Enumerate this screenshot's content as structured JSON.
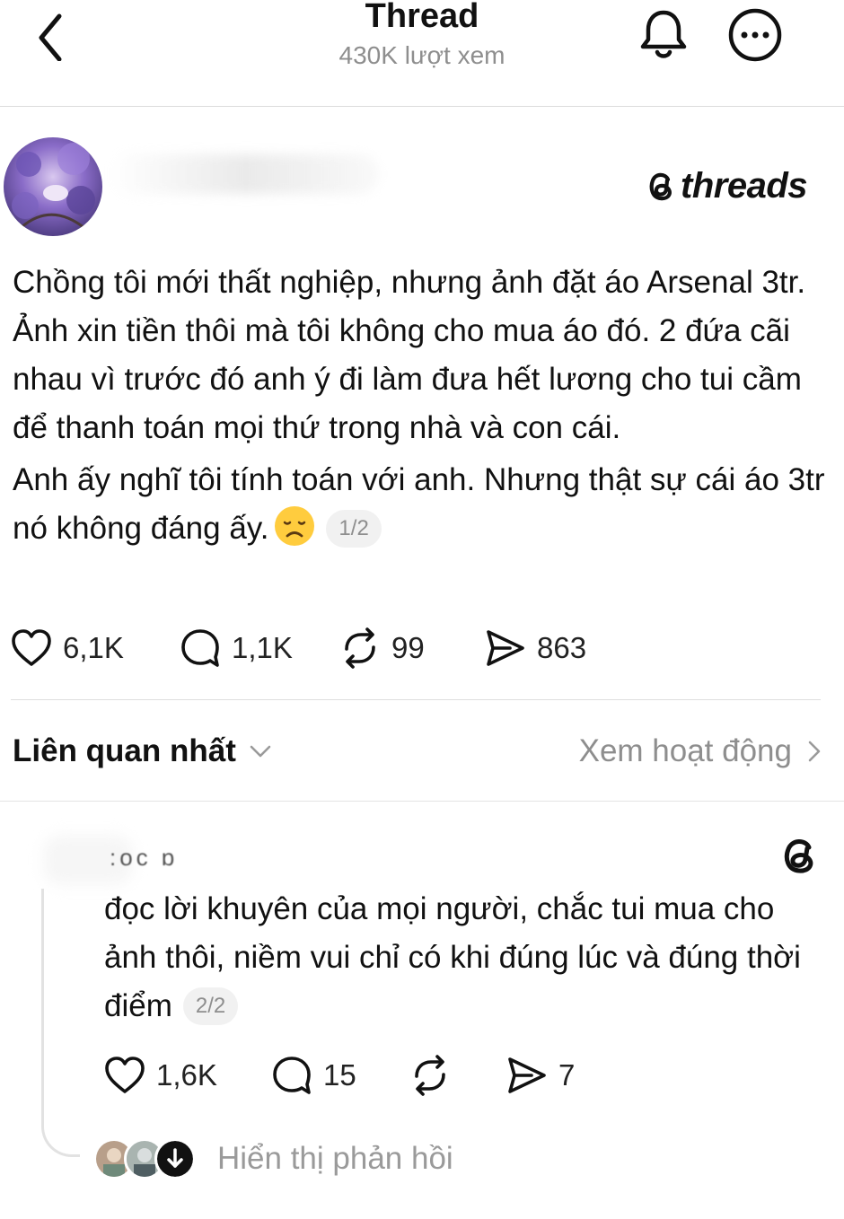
{
  "header": {
    "title": "Thread",
    "views": "430K lượt xem"
  },
  "brand": {
    "name": "threads"
  },
  "post": {
    "paragraph1": "Chồng tôi mới thất nghiệp, nhưng ảnh đặt áo Arsenal 3tr. Ảnh xin tiền thôi mà tôi không cho mua áo đó. 2 đứa cãi nhau vì trước đó anh ý đi làm đưa hết lương cho tui cầm để thanh toán mọi thứ trong nhà và con cái.",
    "paragraph2": "Anh ấy nghĩ tôi tính toán với anh. Nhưng thật sự cái áo 3tr nó không đáng ấy.",
    "page_indicator": "1/2",
    "likes": "6,1K",
    "comments": "1,1K",
    "reposts": "99",
    "shares": "863"
  },
  "sort": {
    "label": "Liên quan nhất",
    "activity_link": "Xem hoạt động"
  },
  "reply": {
    "username": ":oc  ɒ",
    "text": "đọc lời khuyên của mọi người, chắc tui mua cho ảnh thôi, niềm vui chỉ có khi đúng lúc và đúng thời điểm",
    "page_indicator": "2/2",
    "likes": "1,6K",
    "comments": "15",
    "shares": "7",
    "show_replies": "Hiển thị phản hồi"
  },
  "icons": {
    "back": "chevron-left-icon",
    "bell": "bell-icon",
    "more": "more-circle-icon",
    "heart": "heart-icon",
    "comment": "comment-bubble-icon",
    "repost": "repost-icon",
    "share": "send-icon",
    "threads_logo": "threads-logo-icon",
    "emoji": "disappointed-face-emoji"
  }
}
